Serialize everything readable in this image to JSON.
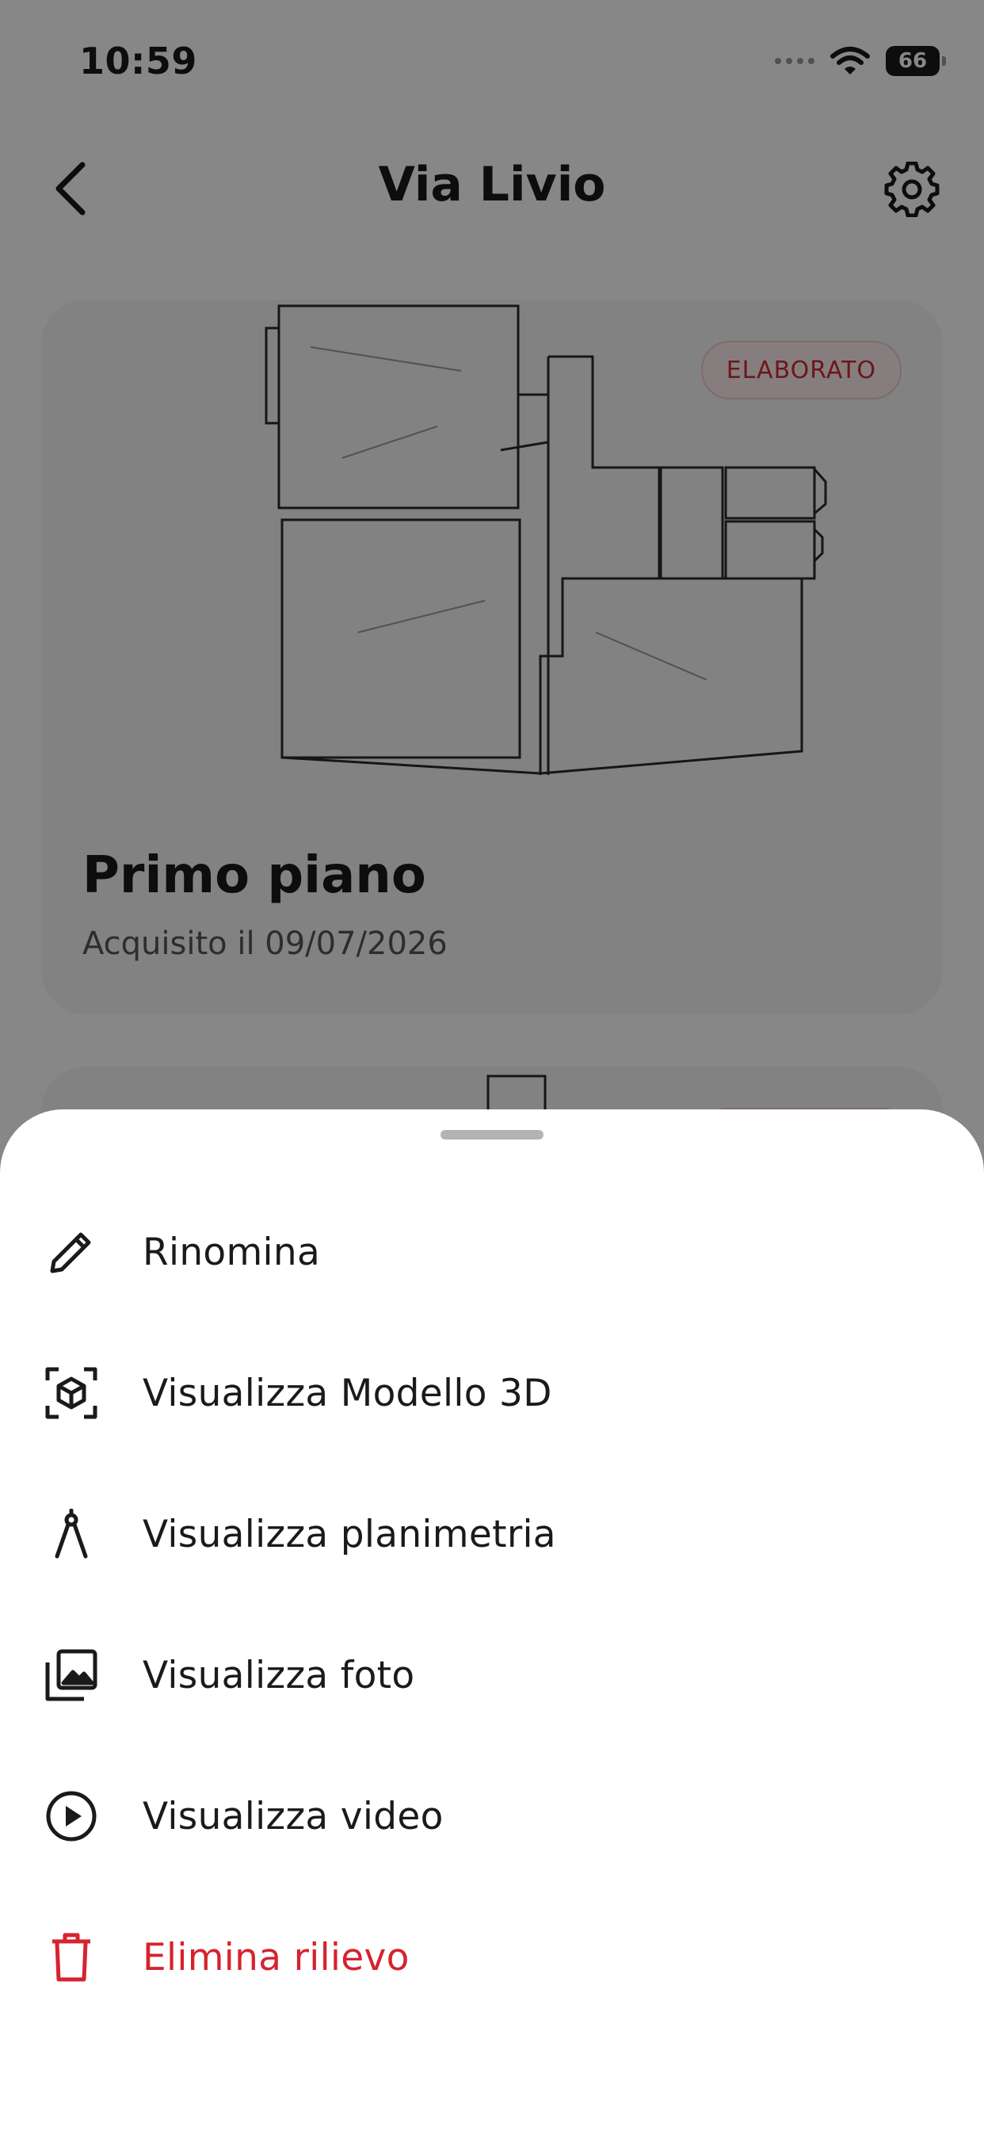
{
  "status_bar": {
    "time": "10:59",
    "battery": "66"
  },
  "nav": {
    "title": "Via Livio",
    "back_icon": "chevron-left-icon",
    "settings_icon": "gear-icon"
  },
  "cards": [
    {
      "badge": "ELABORATO",
      "title": "Primo piano",
      "date": "Acquisito il 09/07/2026"
    }
  ],
  "sheet": {
    "items": [
      {
        "label": "Rinomina",
        "icon": "pencil-icon"
      },
      {
        "label": "Visualizza Modello 3D",
        "icon": "cube-scan-icon"
      },
      {
        "label": "Visualizza planimetria",
        "icon": "compass-icon"
      },
      {
        "label": "Visualizza foto",
        "icon": "photo-library-icon"
      },
      {
        "label": "Visualizza video",
        "icon": "play-circle-icon"
      },
      {
        "label": "Elimina rilievo",
        "icon": "trash-icon"
      }
    ]
  },
  "colors": {
    "accent_red": "#d6232f",
    "badge_bg": "#fdeeee",
    "scrim": "rgba(0,0,0,0.47)"
  }
}
